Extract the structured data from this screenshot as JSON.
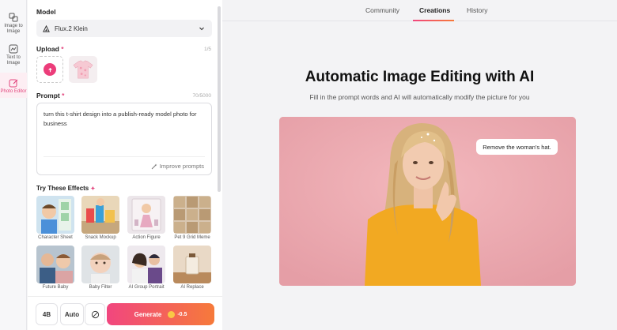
{
  "rail": {
    "items": [
      {
        "label": "Image to Image"
      },
      {
        "label": "Text to Image"
      },
      {
        "label": "Photo Editor"
      }
    ]
  },
  "panel": {
    "model_label": "Model",
    "model_value": "Flux.2 Klein",
    "upload_label": "Upload",
    "upload_required": "*",
    "upload_count": "1/5",
    "prompt_label": "Prompt",
    "prompt_required": "*",
    "prompt_count": "70/5000",
    "prompt_text": "turn this t-shirt design into a publish-ready model photo for business",
    "improve_label": "Improve prompts",
    "effects_label": "Try These Effects",
    "effects": [
      {
        "label": "Character Sheet"
      },
      {
        "label": "Snack Mockup"
      },
      {
        "label": "Action Figure"
      },
      {
        "label": "Pet 9 Grid Meme"
      },
      {
        "label": "Future Baby"
      },
      {
        "label": "Baby Filter"
      },
      {
        "label": "AI Group Portrait"
      },
      {
        "label": "AI Replace"
      }
    ]
  },
  "bottom": {
    "count_label": "4B",
    "aspect_label": "Auto",
    "generate_label": "Generate",
    "cost": "-0.5"
  },
  "main": {
    "tabs": [
      {
        "label": "Community"
      },
      {
        "label": "Creations"
      },
      {
        "label": "History"
      }
    ],
    "active_tab": "Creations",
    "headline": "Automatic Image Editing with AI",
    "subline": "Fill in the prompt words and AI will automatically modify the picture for you",
    "hero_bubble": "Remove the woman's hat."
  },
  "colors": {
    "accent": "#e2457d",
    "generate_start": "#f1467f",
    "generate_end": "#f67a3a"
  }
}
